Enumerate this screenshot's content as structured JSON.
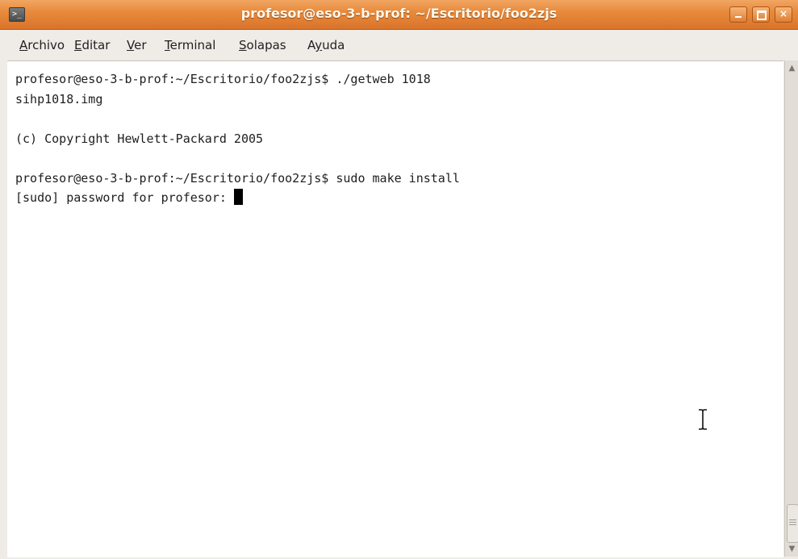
{
  "window": {
    "title": "profesor@eso-3-b-prof: ~/Escritorio/foo2zjs",
    "app_icon": "terminal-icon",
    "controls": {
      "minimize": "minimize-icon",
      "maximize": "maximize-icon",
      "close": "×"
    }
  },
  "menu": {
    "items": [
      {
        "accel": "A",
        "rest": "rchivo"
      },
      {
        "accel": "E",
        "rest": "ditar"
      },
      {
        "accel": "V",
        "rest": "er"
      },
      {
        "accel": "T",
        "rest": "erminal"
      },
      {
        "accel": "S",
        "rest": "olapas"
      },
      {
        "pre": "A",
        "accel": "y",
        "rest": "uda"
      }
    ]
  },
  "terminal": {
    "lines": [
      "profesor@eso-3-b-prof:~/Escritorio/foo2zjs$ ./getweb 1018",
      "sihp1018.img",
      "",
      "(c) Copyright Hewlett-Packard 2005",
      "",
      "profesor@eso-3-b-prof:~/Escritorio/foo2zjs$ sudo make install"
    ],
    "prompt_line": "[sudo] password for profesor: ",
    "cursor": "block-cursor"
  },
  "scrollbar": {
    "position_fraction": 1.0
  },
  "mouse_pointer": "ibeam-cursor-icon"
}
